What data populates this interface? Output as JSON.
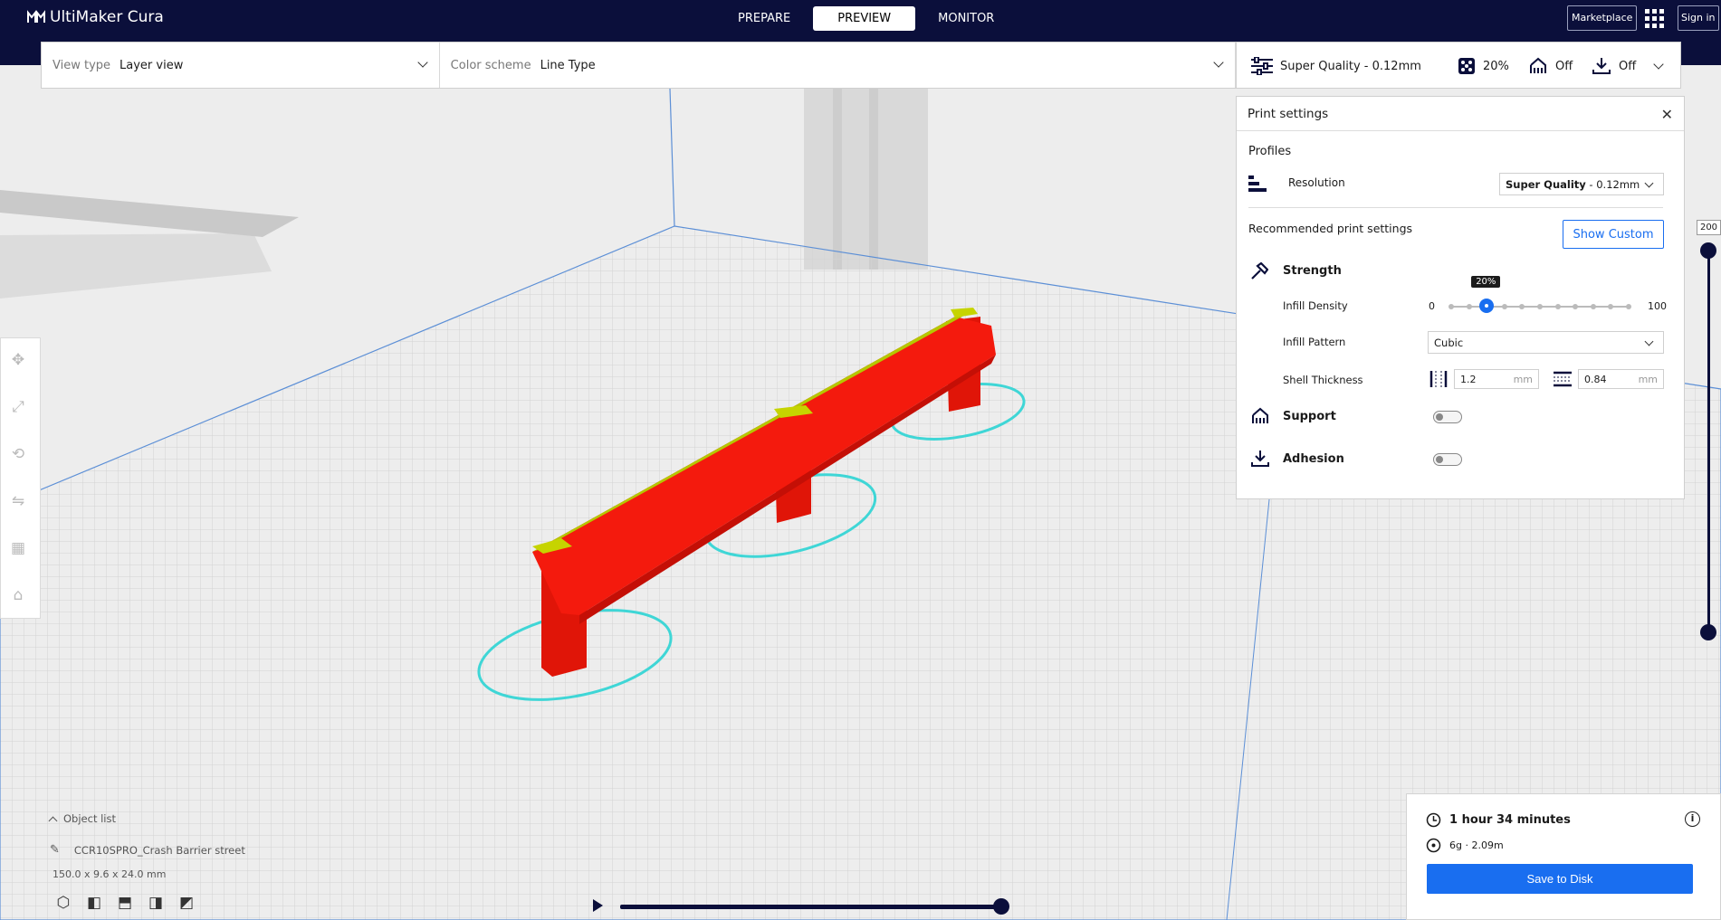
{
  "app": {
    "name": "UltiMaker Cura"
  },
  "header": {
    "tabs": [
      {
        "label": "PREPARE",
        "active": false
      },
      {
        "label": "PREVIEW",
        "active": true
      },
      {
        "label": "MONITOR",
        "active": false
      }
    ],
    "marketplace_label": "Marketplace",
    "signin_label": "Sign in"
  },
  "view_selector": {
    "view_type_label": "View type",
    "view_type_value": "Layer view",
    "color_scheme_label": "Color scheme",
    "color_scheme_value": "Line Type"
  },
  "quality_bar": {
    "profile": "Super Quality - 0.12mm",
    "infill": "20%",
    "support": "Off",
    "adhesion": "Off"
  },
  "print_settings": {
    "title": "Print settings",
    "profiles_label": "Profiles",
    "resolution_label": "Resolution",
    "resolution_value_bold": "Super Quality",
    "resolution_value_rest": " - 0.12mm",
    "recommended_label": "Recommended print settings",
    "show_custom_label": "Show Custom",
    "strength_label": "Strength",
    "infill_density_label": "Infill Density",
    "infill_min": "0",
    "infill_max": "100",
    "infill_value": 20,
    "infill_tooltip": "20%",
    "infill_pattern_label": "Infill Pattern",
    "infill_pattern_value": "Cubic",
    "shell_thickness_label": "Shell Thickness",
    "wall_thickness": "1.2",
    "top_bottom_thickness": "0.84",
    "unit": "mm",
    "support_label": "Support",
    "support_enabled": false,
    "adhesion_label": "Adhesion",
    "adhesion_enabled": false
  },
  "layer_slider": {
    "top_value": "200"
  },
  "object_list": {
    "toggle_label": "Object list",
    "object_name": "CCR10SPRO_Crash Barrier street",
    "dimensions": "150.0 x 9.6 x 24.0 mm"
  },
  "estimate": {
    "time": "1 hour 34 minutes",
    "material": "6g · 2.09m",
    "save_label": "Save to Disk"
  },
  "colors": {
    "header_bg": "#0b0f3b",
    "accent_blue": "#196ef0",
    "model_red": "#f41a0d",
    "skirt_cyan": "#3fd6d6",
    "top_yellow": "#c6d400"
  }
}
